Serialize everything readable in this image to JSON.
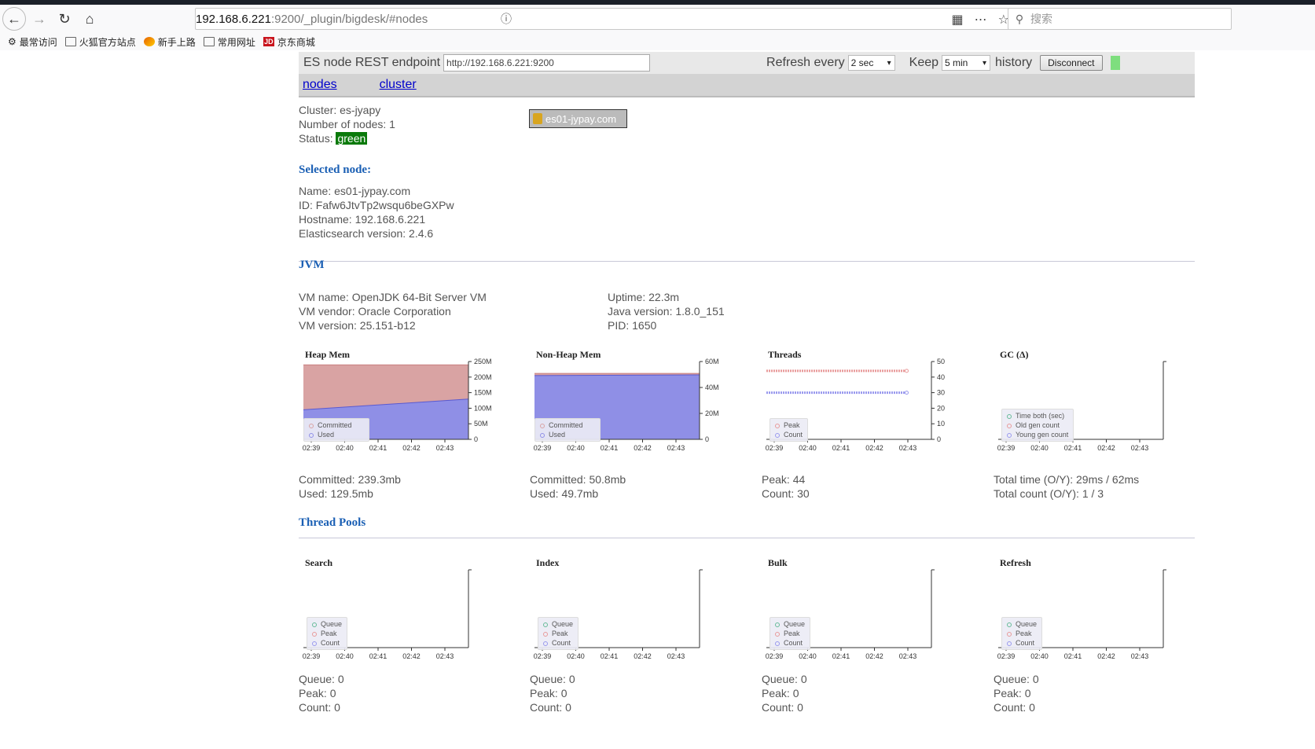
{
  "browser": {
    "url_host": "192.168.6.221",
    "url_path": ":9200/_plugin/bigdesk/#nodes",
    "search_placeholder": "搜索",
    "bookmarks": [
      "最常访问",
      "火狐官方站点",
      "新手上路",
      "常用网址",
      "京东商城"
    ]
  },
  "header": {
    "endpoint_label": "ES node REST endpoint",
    "endpoint_value": "http://192.168.6.221:9200",
    "refresh_label": "Refresh every",
    "refresh_value": "2 sec",
    "keep_label": "Keep",
    "keep_value": "5 min",
    "history_label": "history",
    "disconnect_label": "Disconnect",
    "tabs": [
      "nodes",
      "cluster"
    ]
  },
  "cluster": {
    "cluster_line": "Cluster: es-jyapy",
    "nodes_line": "Number of nodes: 1",
    "status_label": "Status:",
    "status_value": "green",
    "node_chip": "es01-jypay.com"
  },
  "selected_node": {
    "title": "Selected node:",
    "name": "Name: es01-jypay.com",
    "id": "ID: Fafw6JtvTp2wsqu6beGXPw",
    "hostname": "Hostname: 192.168.6.221",
    "es_version": "Elasticsearch version: 2.4.6"
  },
  "jvm": {
    "title": "JVM",
    "vm_name": "VM name: OpenJDK 64-Bit Server VM",
    "vm_vendor": "VM vendor: Oracle Corporation",
    "vm_version": "VM version: 25.151-b12",
    "uptime": "Uptime: 22.3m",
    "java_version": "Java version: 1.8.0_151",
    "pid": "PID: 1650"
  },
  "thread_pools": {
    "title": "Thread Pools"
  },
  "x_ticks": [
    "02:39",
    "02:40",
    "02:41",
    "02:42",
    "02:43"
  ],
  "colors": {
    "committed": "#d9a3a3",
    "used": "#8f8fe6",
    "peak": "#e89a9a",
    "count": "#9999ee",
    "green": "#66bb99"
  },
  "chart_data": [
    {
      "type": "area",
      "title": "Heap Mem",
      "y_ticks": [
        "0",
        "50M",
        "100M",
        "150M",
        "200M",
        "250M"
      ],
      "ylim": [
        0,
        250
      ],
      "x_range": [
        0,
        1
      ],
      "series": [
        {
          "name": "Committed",
          "values": [
            [
              0,
              239.3
            ],
            [
              1,
              239.3
            ]
          ]
        },
        {
          "name": "Used",
          "values": [
            [
              0,
              95
            ],
            [
              1,
              129.5
            ]
          ]
        }
      ],
      "stats": [
        "Committed: 239.3mb",
        "Used: 129.5mb"
      ]
    },
    {
      "type": "area",
      "title": "Non-Heap Mem",
      "y_ticks": [
        "0",
        "20M",
        "40M",
        "60M"
      ],
      "ylim": [
        0,
        60
      ],
      "x_range": [
        0,
        1
      ],
      "series": [
        {
          "name": "Committed",
          "values": [
            [
              0,
              50.8
            ],
            [
              1,
              50.8
            ]
          ]
        },
        {
          "name": "Used",
          "values": [
            [
              0,
              49.2
            ],
            [
              1,
              49.7
            ]
          ]
        }
      ],
      "stats": [
        "Committed: 50.8mb",
        "Used: 49.7mb"
      ]
    },
    {
      "type": "line",
      "title": "Threads",
      "y_ticks": [
        "0",
        "10",
        "20",
        "30",
        "40",
        "50"
      ],
      "ylim": [
        0,
        50
      ],
      "x_range": [
        0,
        1
      ],
      "series": [
        {
          "name": "Peak",
          "values": [
            [
              0,
              44
            ],
            [
              0.73,
              44
            ],
            [
              0.85,
              44
            ]
          ]
        },
        {
          "name": "Count",
          "values": [
            [
              0,
              30
            ],
            [
              0.73,
              30
            ],
            [
              0.85,
              30
            ]
          ]
        }
      ],
      "stats": [
        "Peak: 44",
        "Count: 30"
      ]
    },
    {
      "type": "line",
      "title": "GC (Δ)",
      "ylim": [
        0,
        1
      ],
      "x_range": [
        0,
        1
      ],
      "series": [
        {
          "name": "Time both (sec)",
          "values": []
        },
        {
          "name": "Old gen count",
          "values": []
        },
        {
          "name": "Young gen count",
          "values": []
        }
      ],
      "stats": [
        "Total time (O/Y): 29ms / 62ms",
        "Total count (O/Y): 1 / 3"
      ]
    },
    {
      "type": "line",
      "title": "Search",
      "ylim": [
        0,
        1
      ],
      "x_range": [
        0,
        1
      ],
      "series": [
        {
          "name": "Queue",
          "values": []
        },
        {
          "name": "Peak",
          "values": []
        },
        {
          "name": "Count",
          "values": []
        }
      ],
      "stats": [
        "Queue: 0",
        "Peak: 0",
        "Count: 0"
      ]
    },
    {
      "type": "line",
      "title": "Index",
      "ylim": [
        0,
        1
      ],
      "x_range": [
        0,
        1
      ],
      "series": [
        {
          "name": "Queue",
          "values": []
        },
        {
          "name": "Peak",
          "values": []
        },
        {
          "name": "Count",
          "values": []
        }
      ],
      "stats": [
        "Queue: 0",
        "Peak: 0",
        "Count: 0"
      ]
    },
    {
      "type": "line",
      "title": "Bulk",
      "ylim": [
        0,
        1
      ],
      "x_range": [
        0,
        1
      ],
      "series": [
        {
          "name": "Queue",
          "values": []
        },
        {
          "name": "Peak",
          "values": []
        },
        {
          "name": "Count",
          "values": []
        }
      ],
      "stats": [
        "Queue: 0",
        "Peak: 0",
        "Count: 0"
      ]
    },
    {
      "type": "line",
      "title": "Refresh",
      "ylim": [
        0,
        1
      ],
      "x_range": [
        0,
        1
      ],
      "series": [
        {
          "name": "Queue",
          "values": []
        },
        {
          "name": "Peak",
          "values": []
        },
        {
          "name": "Count",
          "values": []
        }
      ],
      "stats": [
        "Queue: 0",
        "Peak: 0",
        "Count: 0"
      ]
    }
  ]
}
